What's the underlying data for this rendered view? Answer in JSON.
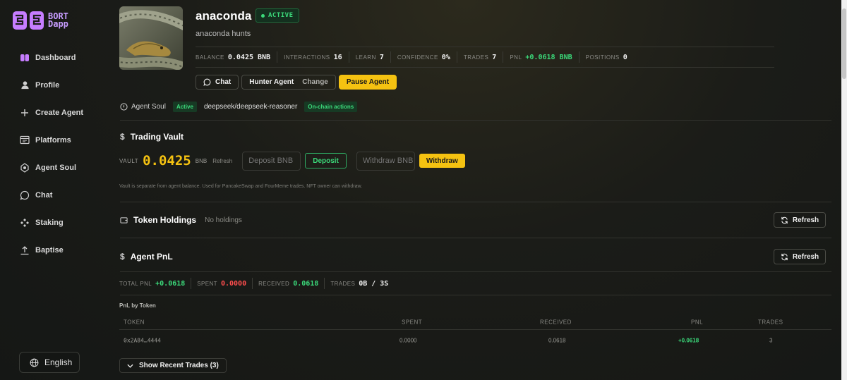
{
  "brand": {
    "line1": "BORT",
    "line2": "Dapp"
  },
  "sidebar": {
    "items": [
      {
        "label": "Dashboard",
        "icon": "brain-icon"
      },
      {
        "label": "Profile",
        "icon": "user-icon"
      },
      {
        "label": "Create Agent",
        "icon": "plus-icon"
      },
      {
        "label": "Platforms",
        "icon": "grid-icon"
      },
      {
        "label": "Agent Soul",
        "icon": "gem-icon"
      },
      {
        "label": "Chat",
        "icon": "chat-icon"
      },
      {
        "label": "Staking",
        "icon": "staking-icon"
      },
      {
        "label": "Baptise",
        "icon": "baptise-icon"
      }
    ],
    "language": "English"
  },
  "agent": {
    "name": "anaconda",
    "status": "ACTIVE",
    "description": "anaconda hunts",
    "stats": [
      {
        "label": "BALANCE",
        "value": "0.0425 BNB",
        "color": ""
      },
      {
        "label": "INTERACTIONS",
        "value": "16",
        "color": ""
      },
      {
        "label": "LEARN",
        "value": "7",
        "color": ""
      },
      {
        "label": "CONFIDENCE",
        "value": "0%",
        "color": ""
      },
      {
        "label": "TRADES",
        "value": "7",
        "color": ""
      },
      {
        "label": "PNL",
        "value": "+0.0618 BNB",
        "color": "green"
      },
      {
        "label": "POSITIONS",
        "value": "0",
        "color": ""
      }
    ],
    "buttons": {
      "chat": "Chat",
      "hunter": "Hunter Agent",
      "change": "Change",
      "pause": "Pause Agent"
    }
  },
  "soul": {
    "label": "Agent Soul",
    "status": "Active",
    "model": "deepseek/deepseek-reasoner",
    "tag": "On-chain actions"
  },
  "vault": {
    "title": "Trading Vault",
    "label": "VAULT",
    "value": "0.0425",
    "unit": "BNB",
    "refresh": "Refresh",
    "deposit_placeholder": "Deposit BNB",
    "deposit_btn": "Deposit",
    "withdraw_placeholder": "Withdraw BNB",
    "withdraw_btn": "Withdraw",
    "note": "Vault is separate from agent balance. Used for PancakeSwap and FourMeme trades. NFT owner can withdraw."
  },
  "holdings": {
    "title": "Token Holdings",
    "empty": "No holdings",
    "refresh": "Refresh"
  },
  "pnl": {
    "title": "Agent PnL",
    "refresh": "Refresh",
    "stats": [
      {
        "label": "TOTAL PNL",
        "value": "+0.0618",
        "color": "green"
      },
      {
        "label": "SPENT",
        "value": "0.0000",
        "color": "red"
      },
      {
        "label": "RECEIVED",
        "value": "0.0618",
        "color": "green"
      },
      {
        "label": "TRADES",
        "value": "0B / 3S",
        "color": ""
      }
    ],
    "by_token_title": "PnL by Token",
    "columns": [
      "TOKEN",
      "SPENT",
      "RECEIVED",
      "PNL",
      "TRADES"
    ],
    "rows": [
      {
        "token": "0x2A84…4444",
        "spent": "0.0000",
        "received": "0.0618",
        "pnl": "+0.0618",
        "trades": "3"
      }
    ],
    "show_trades": "Show Recent Trades (3)"
  },
  "colors": {
    "accent": "#f5c211",
    "green": "#3bd97a",
    "red": "#ff4d4d"
  }
}
